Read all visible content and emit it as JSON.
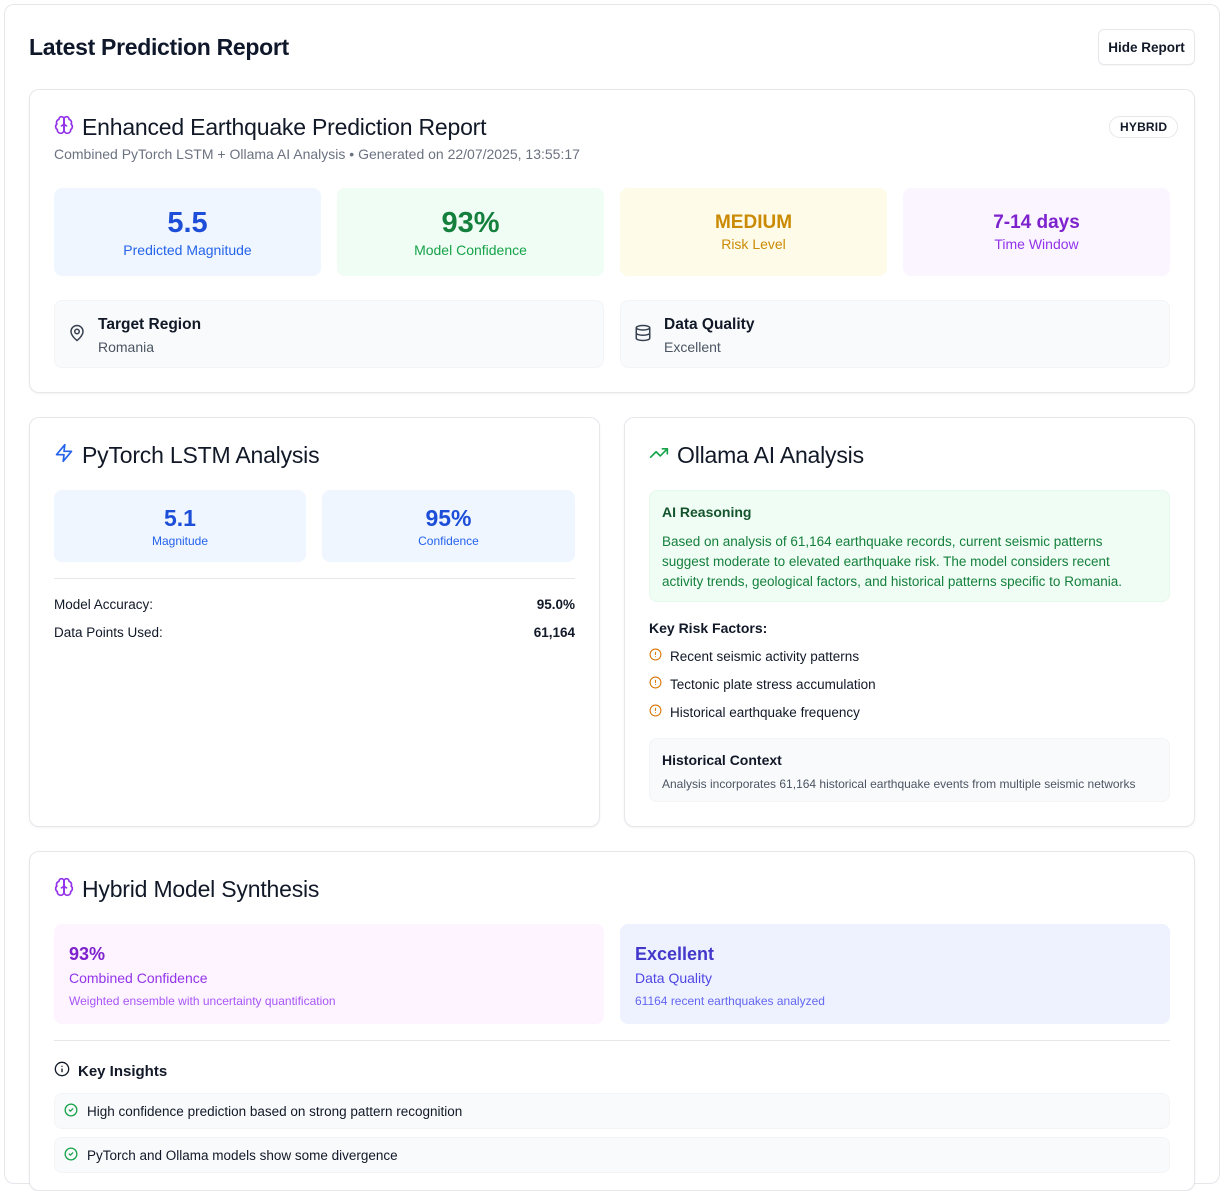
{
  "header": {
    "title": "Latest Prediction Report",
    "hide_button": "Hide Report"
  },
  "report": {
    "icon": "brain-icon",
    "title": "Enhanced Earthquake Prediction Report",
    "subtitle": "Combined PyTorch LSTM + Ollama AI Analysis • Generated on 22/07/2025, 13:55:17",
    "badge": "HYBRID",
    "stats": [
      {
        "value": "5.5",
        "label": "Predicted Magnitude",
        "bg": "#eff6ff",
        "color": "#1d4ed8",
        "label_color": "#2563eb"
      },
      {
        "value": "93%",
        "label": "Model Confidence",
        "bg": "#f0fdf4",
        "color": "#15803d",
        "label_color": "#16a34a"
      },
      {
        "value": "MEDIUM",
        "label": "Risk Level",
        "bg": "#fefce8",
        "color": "#ca8a04",
        "label_color": "#ca8a04"
      },
      {
        "value": "7-14 days",
        "label": "Time Window",
        "bg": "#faf5ff",
        "color": "#7e22ce",
        "label_color": "#9333ea"
      }
    ],
    "target_region": {
      "icon": "map-pin-icon",
      "title": "Target Region",
      "value": "Romania"
    },
    "data_quality": {
      "icon": "database-icon",
      "title": "Data Quality",
      "value": "Excellent"
    }
  },
  "lstm": {
    "icon": "lightning-icon",
    "title": "PyTorch LSTM Analysis",
    "magnitude": {
      "value": "5.1",
      "label": "Magnitude"
    },
    "confidence": {
      "value": "95%",
      "label": "Confidence"
    },
    "rows": [
      {
        "key": "Model Accuracy:",
        "value": "95.0%"
      },
      {
        "key": "Data Points Used:",
        "value": "61,164"
      }
    ]
  },
  "ollama": {
    "icon": "trending-up-icon",
    "title": "Ollama AI Analysis",
    "reasoning_title": "AI Reasoning",
    "reasoning_text": "Based on analysis of 61,164 earthquake records, current seismic patterns suggest moderate to elevated earthquake risk. The model considers recent activity trends, geological factors, and historical patterns specific to Romania.",
    "risk_factors_title": "Key Risk Factors:",
    "risk_factors": [
      "Recent seismic activity patterns",
      "Tectonic plate stress accumulation",
      "Historical earthquake frequency"
    ],
    "history_title": "Historical Context",
    "history_text": "Analysis incorporates 61,164 historical earthquake events from multiple seismic networks"
  },
  "synthesis": {
    "icon": "brain-icon",
    "title": "Hybrid Model Synthesis",
    "combined": {
      "value": "93%",
      "label": "Combined Confidence",
      "note": "Weighted ensemble with uncertainty quantification"
    },
    "quality": {
      "value": "Excellent",
      "label": "Data Quality",
      "note": "61164 recent earthquakes analyzed"
    },
    "insights_title": "Key Insights",
    "insights": [
      "High confidence prediction based on strong pattern recognition",
      "PyTorch and Ollama models show some divergence"
    ]
  },
  "colors": {
    "brain_purple": "#9333ea",
    "lightning_blue": "#2563eb",
    "trend_green": "#16a34a",
    "alert_orange": "#d97706",
    "check_green": "#16a34a"
  }
}
